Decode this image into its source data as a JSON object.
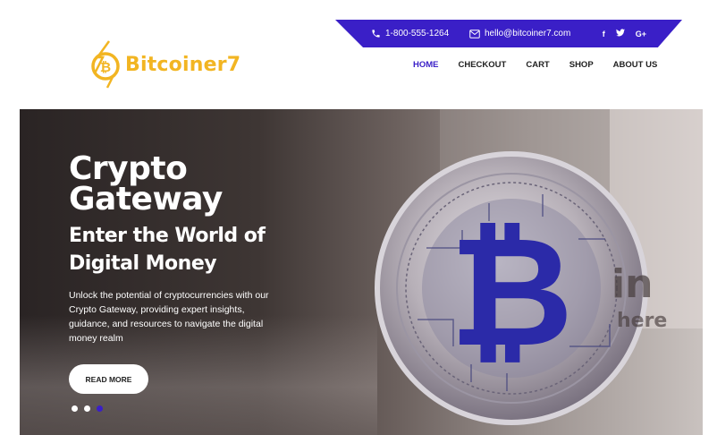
{
  "brand": {
    "name": "Bitcoiner7",
    "color": "#f2b522"
  },
  "topbar": {
    "phone": "1-800-555-1264",
    "email": "hello@bitcoiner7.com",
    "social": [
      "f",
      "t",
      "G+"
    ],
    "color": "#3a1fc7"
  },
  "nav": {
    "items": [
      {
        "label": "HOME"
      },
      {
        "label": "CHECKOUT"
      },
      {
        "label": "CART"
      },
      {
        "label": "SHOP"
      },
      {
        "label": "ABOUT US"
      }
    ],
    "active": "HOME"
  },
  "hero": {
    "title": "Crypto Gateway",
    "subtitle": "Enter the World of Digital Money",
    "description": "Unlock the potential of cryptocurrencies with our Crypto Gateway, providing expert insights, guidance, and resources to navigate the digital money realm",
    "button": "READ MORE",
    "slides": 3,
    "active_slide": 3,
    "watermark_in": "in",
    "watermark_here": "here"
  }
}
